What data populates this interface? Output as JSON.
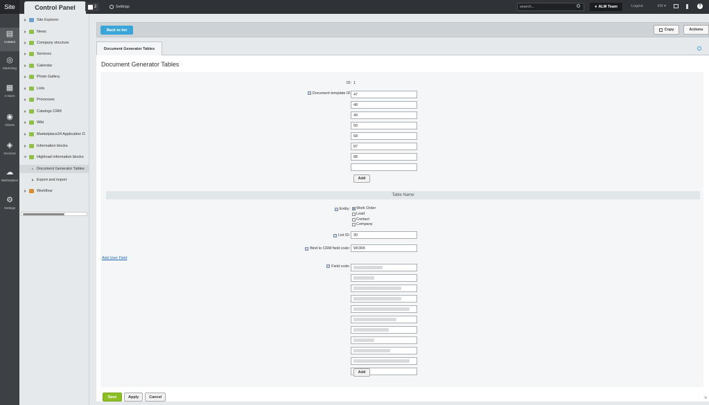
{
  "topbar": {
    "site_label": "Site",
    "control_panel_label": "Control Panel",
    "notifications_count": "2",
    "settings_label": "Settings",
    "search_placeholder": "search...",
    "user_label": "ALM Team",
    "logout_label": "Logout",
    "lang_label": "EN"
  },
  "leftbar": {
    "items": [
      {
        "label": "Content",
        "icon": "document-icon"
      },
      {
        "label": "Marketing",
        "icon": "target-icon"
      },
      {
        "label": "e-Store",
        "icon": "basket-icon"
      },
      {
        "label": "Clients",
        "icon": "clients-icon"
      },
      {
        "label": "Services",
        "icon": "layers-icon"
      },
      {
        "label": "Marketplace",
        "icon": "cloud-icon"
      },
      {
        "label": "Settings",
        "icon": "gear-icon"
      }
    ]
  },
  "tree": {
    "items": [
      {
        "label": "Site Explorer"
      },
      {
        "label": "News"
      },
      {
        "label": "Company structure"
      },
      {
        "label": "Services"
      },
      {
        "label": "Calendar"
      },
      {
        "label": "Photo Gallery"
      },
      {
        "label": "Lists"
      },
      {
        "label": "Processes"
      },
      {
        "label": "Catalogs CRM"
      },
      {
        "label": "Wiki"
      },
      {
        "label": "Marketplace24 Application D"
      },
      {
        "label": "Information blocks"
      },
      {
        "label": "Highload information blocks"
      },
      {
        "label": "Document Generator Tables"
      },
      {
        "label": "Export and import"
      },
      {
        "label": "Workflow"
      }
    ]
  },
  "toolbar": {
    "back_label": "Back to list",
    "copy_label": "Copy",
    "actions_label": "Actions"
  },
  "tab": {
    "label": "Document Generator Tables"
  },
  "panel": {
    "title": "Document Generator Tables"
  },
  "form": {
    "id_label": "ID:",
    "id_value": "1",
    "template_label": "Document template ID:",
    "template_values": [
      "47",
      "48",
      "49",
      "50",
      "68",
      "87",
      "88",
      ""
    ],
    "add_label": "Add",
    "section_title": "Table Name",
    "entity_label": "Entity:",
    "entity_options": [
      {
        "label": "Work Order",
        "checked": true
      },
      {
        "label": "Lead",
        "checked": false
      },
      {
        "label": "Contact",
        "checked": false
      },
      {
        "label": "Company",
        "checked": false
      }
    ],
    "list_id_label": "List ID:",
    "list_id_value": "30",
    "bind_label": "Bind to CRM field code:",
    "bind_value": "WORK",
    "add_user_field": "Add User Field",
    "field_code_label": "Field code:",
    "field_code_count": 11,
    "add_label_2": "Add"
  },
  "footer": {
    "save_label": "Save",
    "apply_label": "Apply",
    "cancel_label": "Cancel"
  },
  "colors": {
    "topbar": "#2f3236",
    "accent_blue": "#3aa5d8",
    "save_green": "#8cbf26"
  }
}
